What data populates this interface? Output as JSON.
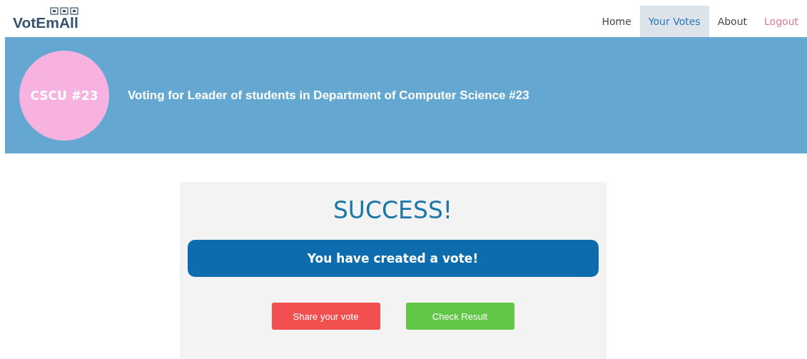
{
  "logo": {
    "text": "VotEmAll"
  },
  "nav": [
    {
      "label": "Home",
      "selected": false,
      "kind": "link"
    },
    {
      "label": "Your Votes",
      "selected": true,
      "kind": "link"
    },
    {
      "label": "About",
      "selected": false,
      "kind": "link"
    },
    {
      "label": "Logout",
      "selected": false,
      "kind": "logout"
    }
  ],
  "banner": {
    "badge": "CSCU #23",
    "title": "Voting for Leader of students in Department of Computer Science #23"
  },
  "result": {
    "heading": "SUCCESS!",
    "message": "You have created a vote!",
    "buttons": [
      {
        "label": "Share your vote",
        "kind": "danger"
      },
      {
        "label": "Check Result",
        "kind": "success"
      }
    ]
  }
}
